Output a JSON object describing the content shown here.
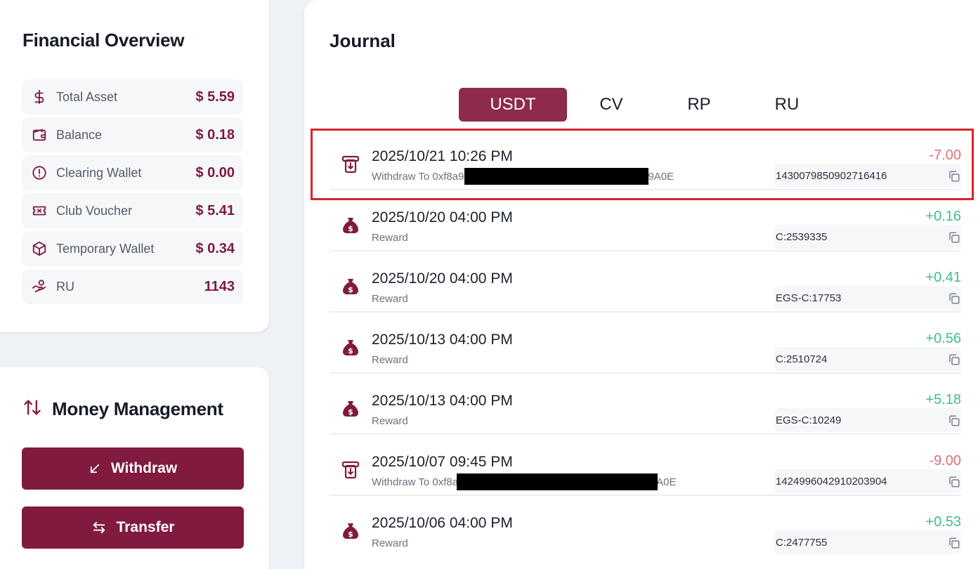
{
  "financial": {
    "title": "Financial Overview",
    "rows": [
      {
        "label": "Total Asset",
        "value": "$ 5.59",
        "icon": "dollar-icon"
      },
      {
        "label": "Balance",
        "value": "$ 0.18",
        "icon": "wallet-icon"
      },
      {
        "label": "Clearing Wallet",
        "value": "$ 0.00",
        "icon": "alert-circle-icon"
      },
      {
        "label": "Club Voucher",
        "value": "$ 5.41",
        "icon": "ticket-icon"
      },
      {
        "label": "Temporary Wallet",
        "value": "$ 0.34",
        "icon": "box-icon"
      },
      {
        "label": "RU",
        "value": "1143",
        "icon": "hand-coins-icon"
      }
    ]
  },
  "money": {
    "title": "Money Management",
    "withdraw_label": "Withdraw",
    "transfer_label": "Transfer"
  },
  "journal": {
    "title": "Journal",
    "tabs": [
      "USDT",
      "CV",
      "RP",
      "RU"
    ],
    "active_tab": "USDT",
    "entries": [
      {
        "date": "2025/10/21 10:26 PM",
        "desc": "Withdraw To 0xf8a9",
        "desc_tail": "9A0E",
        "amount": "-7.00",
        "ref": "1430079850902716416",
        "type": "withdraw"
      },
      {
        "date": "2025/10/20 04:00 PM",
        "desc": "Reward",
        "desc_tail": "",
        "amount": "+0.16",
        "ref": "C:2539335",
        "type": "reward"
      },
      {
        "date": "2025/10/20 04:00 PM",
        "desc": "Reward",
        "desc_tail": "",
        "amount": "+0.41",
        "ref": "EGS-C:17753",
        "type": "reward"
      },
      {
        "date": "2025/10/13 04:00 PM",
        "desc": "Reward",
        "desc_tail": "",
        "amount": "+0.56",
        "ref": "C:2510724",
        "type": "reward"
      },
      {
        "date": "2025/10/13 04:00 PM",
        "desc": "Reward",
        "desc_tail": "",
        "amount": "+5.18",
        "ref": "EGS-C:10249",
        "type": "reward"
      },
      {
        "date": "2025/10/07 09:45 PM",
        "desc": "Withdraw To 0xf8a",
        "desc_tail": "A0E",
        "amount": "-9.00",
        "ref": "1424996042910203904",
        "type": "withdraw"
      },
      {
        "date": "2025/10/06 04:00 PM",
        "desc": "Reward",
        "desc_tail": "",
        "amount": "+0.53",
        "ref": "C:2477755",
        "type": "reward"
      }
    ]
  },
  "colors": {
    "accent": "#801a3f",
    "tab_active": "#8e2a4a",
    "negative": "#e0707a",
    "positive": "#3fbf87",
    "highlight": "#d9242c"
  }
}
